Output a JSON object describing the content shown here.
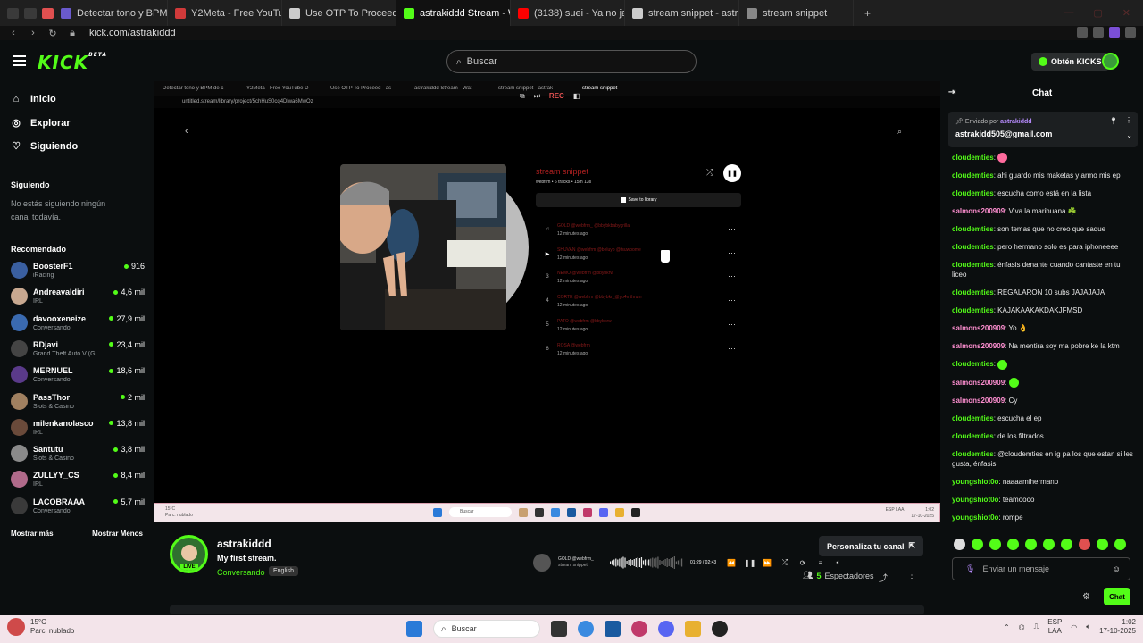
{
  "browser": {
    "tabs": [
      {
        "label": "Detectar tono y BPM de c",
        "color": "#6a5acd"
      },
      {
        "label": "Y2Meta - Free YouTube D",
        "color": "#d03a3a"
      },
      {
        "label": "Use OTP To Proceed - as",
        "color": "#cccccc"
      },
      {
        "label": "astrakiddd Stream - Wat",
        "color": "#53fc18"
      },
      {
        "label": "(3138) suei - Ya no jaja (L",
        "color": "#ff0000"
      },
      {
        "label": "stream snippet - astrakidd",
        "color": "#cccccc"
      },
      {
        "label": "stream snippet",
        "color": "#888888"
      }
    ],
    "url": "kick.com/astrakiddd"
  },
  "header": {
    "logo": "KICK",
    "logo_badge": "BETA",
    "search_placeholder": "Buscar",
    "kicks_button": "Obtén KICKS"
  },
  "sidebar": {
    "nav": [
      {
        "label": "Inicio",
        "icon": "home-icon"
      },
      {
        "label": "Explorar",
        "icon": "compass-icon"
      },
      {
        "label": "Siguiendo",
        "icon": "heart-icon"
      }
    ],
    "following_title": "Siguiendo",
    "following_empty": "No estás siguiendo ningún canal todavía.",
    "recommended_title": "Recomendado",
    "recommended": [
      {
        "name": "BoosterF1",
        "category": "iRacing",
        "viewers": "916",
        "color": "#3a5fa0"
      },
      {
        "name": "Andreavaldiri",
        "category": "IRL",
        "viewers": "4,6 mil",
        "color": "#c8a890"
      },
      {
        "name": "davooxeneize",
        "category": "Conversando",
        "viewers": "27,9 mil",
        "color": "#3a6ab0"
      },
      {
        "name": "RDjavi",
        "category": "Grand Theft Auto V (G...",
        "viewers": "23,4 mil",
        "color": "#444444"
      },
      {
        "name": "MERNUEL",
        "category": "Conversando",
        "viewers": "18,6 mil",
        "color": "#5a3a8a"
      },
      {
        "name": "PassThor",
        "category": "Slots & Casino",
        "viewers": "2 mil",
        "color": "#a08060"
      },
      {
        "name": "milenkanolasco",
        "category": "IRL",
        "viewers": "13,8 mil",
        "color": "#6a4a3a"
      },
      {
        "name": "Santutu",
        "category": "Slots & Casino",
        "viewers": "3,8 mil",
        "color": "#8a8a8a"
      },
      {
        "name": "ZULLYY_CS",
        "category": "IRL",
        "viewers": "8,4 mil",
        "color": "#b06a8a"
      },
      {
        "name": "LACOBRAAA",
        "category": "Conversando",
        "viewers": "5,7 mil",
        "color": "#3a3a3a"
      }
    ],
    "show_more": "Mostrar más",
    "show_less": "Mostrar Menos"
  },
  "video": {
    "inner_tabs": [
      "Detectar tono y BPM de c",
      "Y2Meta - Free YouTube D",
      "Use OTP To Proceed - as",
      "astrakiddd Stream - Wat",
      "stream snippet - astrak",
      "stream snippet"
    ],
    "inner_url": "untitled.stream/library/project/5chHuS0cq4Dlwa6MwOz",
    "overlay_label": "REC",
    "playlist_title": "stream snippet",
    "playlist_meta": "webfrm • 6 tracks • 15m 13s",
    "save_label": "Save to library",
    "tracks": [
      {
        "num": "",
        "title": "GOLD @webfrm_ @bbybkbabygrilla",
        "age": "12 minutes ago"
      },
      {
        "num": "",
        "title": "SHUVAN @webfrm @beluyo @tsuwoome",
        "age": "12 minutes ago"
      },
      {
        "num": "3",
        "title": "NEMO @webfrm @bbybkrw",
        "age": "12 minutes ago"
      },
      {
        "num": "4",
        "title": "CORTE @webfrm @bbybkr_@yo4mthrum",
        "age": "12 minutes ago"
      },
      {
        "num": "5",
        "title": "PATO @webfrm @bbybkrw",
        "age": "12 minutes ago"
      },
      {
        "num": "6",
        "title": "ROSA @webfrm",
        "age": "12 minutes ago"
      }
    ],
    "now_playing_title": "GOLD @webfrm_",
    "now_playing_sub": "stream snippet",
    "now_playing_time": "01:29 / 02:43",
    "progress": 0.55,
    "inner_weather": "15°C",
    "inner_weather_desc": "Parc. nublado",
    "inner_search": "Buscar",
    "inner_lang": "ESP LAA",
    "inner_time": "1:02",
    "inner_date": "17-10-2025"
  },
  "stream": {
    "name": "astrakiddd",
    "title": "My first stream.",
    "category": "Conversando",
    "language": "English",
    "live": "LIVE",
    "customize_button": "Personaliza tu canal",
    "viewers_count": "5",
    "viewers_label": "Espectadores"
  },
  "chat": {
    "title": "Chat",
    "pinned_by_label": "Enviado por",
    "pinned_by_user": "astrakiddd",
    "pinned_message": "astrakidd505@gmail.com",
    "messages": [
      {
        "user": "cloudemties",
        "text": "",
        "color": "green"
      },
      {
        "user": "cloudemties",
        "text": "ahi guardo mis maketas y armo mis ep",
        "color": "green"
      },
      {
        "user": "cloudemties",
        "text": "escucha como está en la lista",
        "color": "green"
      },
      {
        "user": "salmons200909",
        "text": "Viva la marihuana ☘️",
        "color": "pink"
      },
      {
        "user": "cloudemties",
        "text": "son temas que no creo que saque",
        "color": "green"
      },
      {
        "user": "cloudemties",
        "text": "pero hermano solo es para iphoneeee",
        "color": "green"
      },
      {
        "user": "cloudemties",
        "text": "énfasis denante cuando cantaste en tu liceo",
        "color": "green"
      },
      {
        "user": "cloudemties",
        "text": "REGALARON 10 subs JAJAJAJA",
        "color": "green"
      },
      {
        "user": "cloudemties",
        "text": "KAJAKAAKAKDAKJFMSD",
        "color": "green"
      },
      {
        "user": "salmons200909",
        "text": "Yo 👌",
        "color": "pink"
      },
      {
        "user": "salmons200909",
        "text": "Na mentira soy ma pobre ke la ktm",
        "color": "pink"
      },
      {
        "user": "cloudemties",
        "text": "",
        "color": "green"
      },
      {
        "user": "salmons200909",
        "text": "",
        "color": "pink"
      },
      {
        "user": "salmons200909",
        "text": "Cy",
        "color": "pink"
      },
      {
        "user": "cloudemties",
        "text": "escucha el ep",
        "color": "green"
      },
      {
        "user": "cloudemties",
        "text": "de los filtrados",
        "color": "green"
      },
      {
        "user": "cloudemties",
        "text": "@cloudemties en ig pa los que estan si les gusta, énfasis",
        "color": "green"
      },
      {
        "user": "youngshiot0o",
        "text": "naaaamihermano",
        "color": "green"
      },
      {
        "user": "youngshiot0o",
        "text": "teamoooo",
        "color": "green"
      },
      {
        "user": "youngshiot0o",
        "text": "rompe",
        "color": "green"
      }
    ],
    "input_placeholder": "Enviar un mensaje",
    "send_button": "Chat"
  },
  "taskbar": {
    "weather_temp": "15°C",
    "weather_desc": "Parc. nublado",
    "search_placeholder": "Buscar",
    "lang": "ESP",
    "lang_sub": "LAA",
    "time": "1:02",
    "date": "17-10-2025"
  }
}
